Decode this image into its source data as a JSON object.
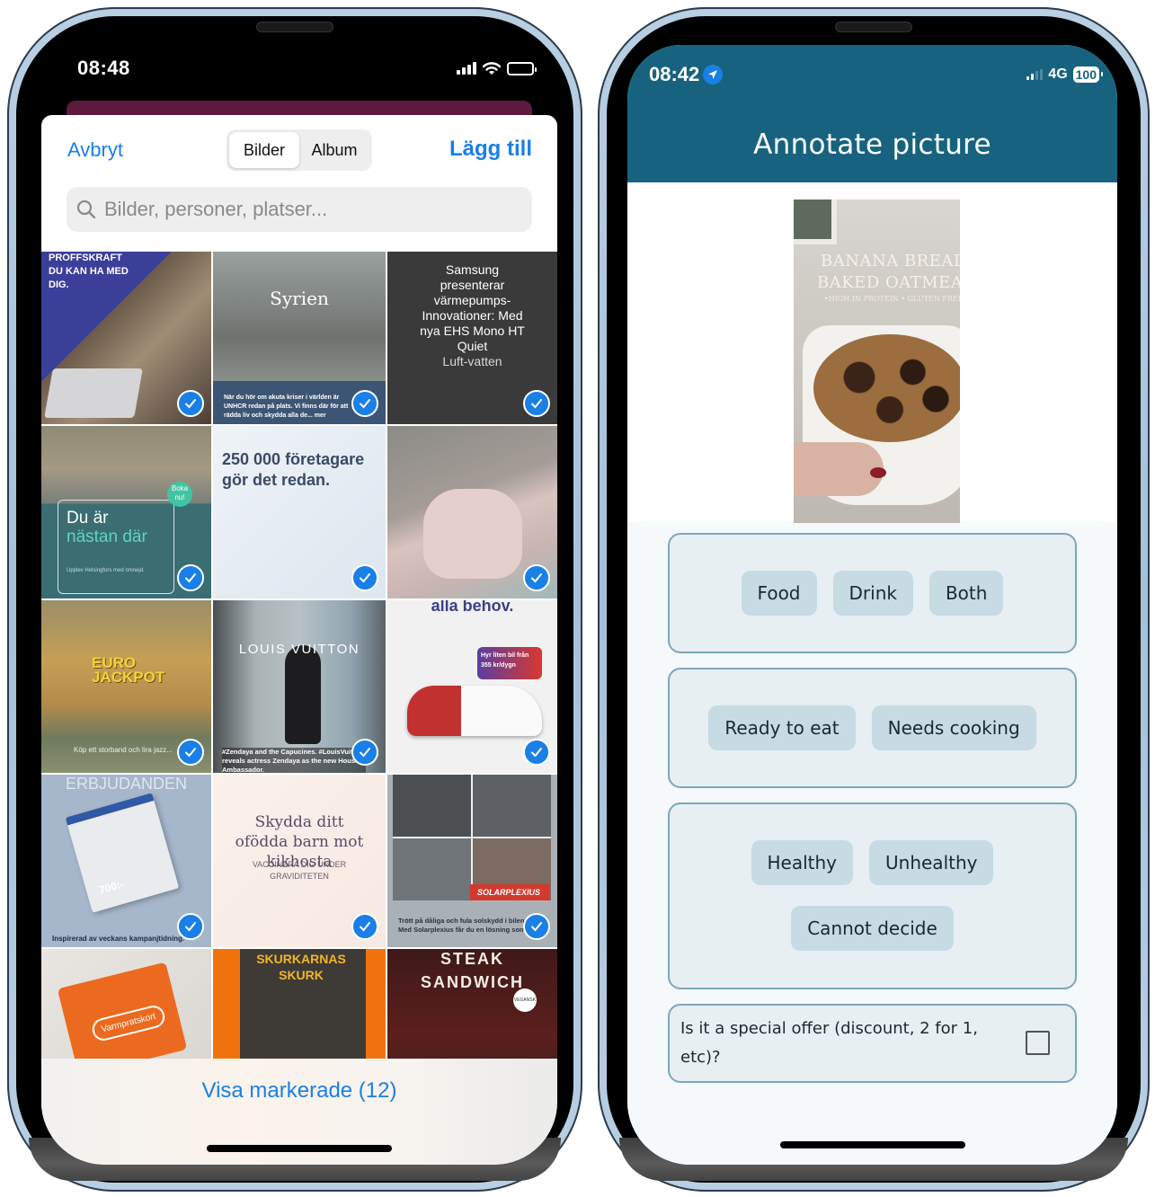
{
  "left_phone": {
    "status_bar": {
      "time": "08:48",
      "icons": [
        "cellular-signal-icon",
        "wifi-icon",
        "battery-icon"
      ]
    },
    "picker": {
      "cancel_label": "Avbryt",
      "add_label": "Lägg till",
      "segments": [
        {
          "label": "Bilder",
          "selected": true
        },
        {
          "label": "Album",
          "selected": false
        }
      ],
      "search": {
        "placeholder": "Bilder, personer, platser...",
        "value": ""
      },
      "photos": [
        {
          "caption": "PROFFSKRAFT DU KAN HA MED DIG.",
          "selected": true
        },
        {
          "caption": "Syrien",
          "subcaption": "När du hör om akuta kriser i världen är UNHCR redan på plats. Vi finns där för att rädda liv och skydda alla de... mer",
          "selected": true
        },
        {
          "caption": "Samsung presenterar värmepumps-Innovationer: Med nya EHS Mono HT Quiet",
          "subcaption": "Luft-vatten",
          "selected": true
        },
        {
          "caption": "Du är",
          "subcaption": "nästan där",
          "badge": "Boka nu!",
          "footer": "Upplev Helsingfors med omnejd.",
          "selected": true
        },
        {
          "caption": "250 000 företagare gör det redan.",
          "selected": true
        },
        {
          "caption": "",
          "selected": true
        },
        {
          "caption": "EURO JACKPOT",
          "subcaption": "Köp ett storband och lira jazz...",
          "selected": true
        },
        {
          "caption": "LOUIS VUITTON",
          "subcaption": "#Zendaya and the Capucines. #LouisVuitton reveals actress Zendaya as the new House Ambassador.",
          "selected": true
        },
        {
          "caption": "alla behov.",
          "subcaption": "Hyr liten bil från 355 kr/dygn",
          "selected": true
        },
        {
          "caption": "ERBJUDANDEN",
          "subcaption": "Inspirerad av veckans kampanjtidning.",
          "price": "700:-",
          "selected": true
        },
        {
          "caption": "Skydda ditt ofödda barn mot kikhosta",
          "subcaption": "VACCINERA DIG UNDER GRAVIDITETEN",
          "selected": true
        },
        {
          "caption": "SOLARPLEXIUS",
          "subcaption": "Trött på dåliga och fula solskydd i bilen? Med Solarplexius får du en lösning som",
          "selected": true
        },
        {
          "caption": "Varmpratskort",
          "selected": false
        },
        {
          "caption": "SKURKARNAS SKURK",
          "selected": false
        },
        {
          "caption": "STEAK SANDWICH",
          "badge": "VEGANSK",
          "selected": false
        }
      ],
      "show_selected_label": "Visa markerade (12)"
    }
  },
  "right_phone": {
    "status_bar": {
      "time": "08:42",
      "network": "4G",
      "battery": "100"
    },
    "header": {
      "title": "Annotate picture"
    },
    "image": {
      "title_line1": "BANANA BREAD",
      "title_line2": "BAKED OATMEAL",
      "title_line3": "•HIGH IN PROTEIN • GLUTEN FREE"
    },
    "questions": [
      {
        "type": "choice",
        "options": [
          "Food",
          "Drink",
          "Both"
        ]
      },
      {
        "type": "choice",
        "options": [
          "Ready to eat",
          "Needs cooking"
        ]
      },
      {
        "type": "choice",
        "options": [
          "Healthy",
          "Unhealthy",
          "Cannot decide"
        ]
      },
      {
        "type": "checkbox",
        "label": "Is it a special offer (discount, 2 for 1, etc)?",
        "checked": false
      }
    ]
  }
}
